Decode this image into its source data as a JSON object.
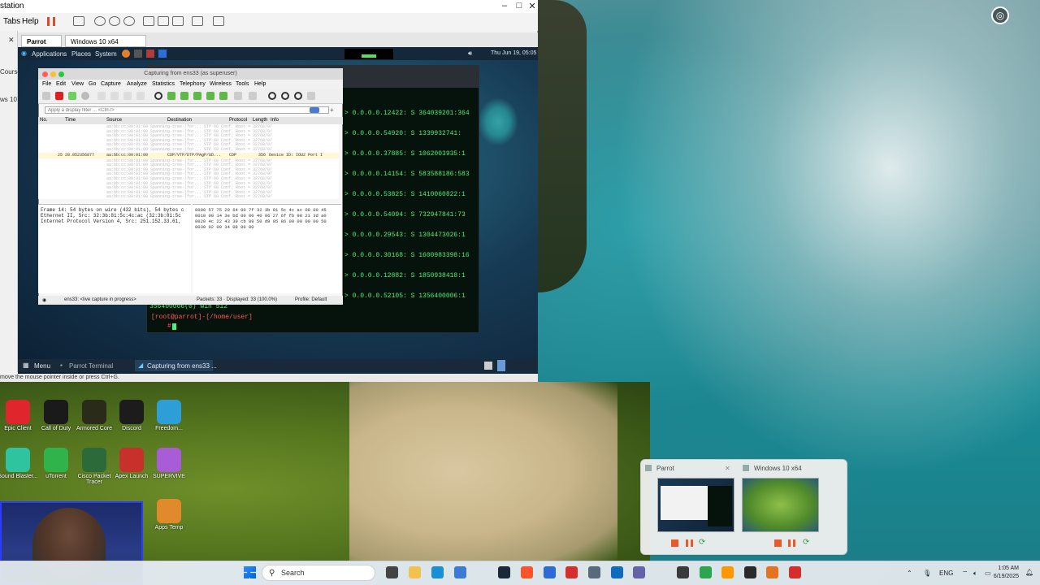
{
  "host": {
    "window_title": "station",
    "menu": [
      "Tabs",
      "Help"
    ],
    "tabs": [
      "Parrot",
      "Windows 10 x64"
    ],
    "left_panel": [
      "Course",
      "ws 10"
    ],
    "status_hint": "move the mouse pointer inside or press Ctrl+G."
  },
  "parrot": {
    "panel": {
      "applications": "Applications",
      "places": "Places",
      "system": "System",
      "clock": "Thu Jun 19, 05:05"
    },
    "bottom": {
      "menu": "Menu",
      "task1": "Parrot Terminal",
      "task2": "Capturing from ens33 ..."
    }
  },
  "terminal": {
    "lines": [
      "> 0.0.0.0.12422: S 364039201:364",
      "> 0.0.0.0.54920: S 1339932741:",
      "> 0.0.0.0.37885: S 1062003935:1",
      "> 0.0.0.0.14154: S 583588186:583",
      "> 0.0.0.0.53825: S 1410060822:1",
      "> 0.0.0.0.54094: S 732947841:73",
      "> 0.0.0.0.29543: S 1304473026:1",
      "> 0.0.0.0.30168: S 1600983398:16",
      "> 0.0.0.0.12882: S 1850938418:1",
      "> 0.0.0.0.52105: S 1356400006:1"
    ],
    "last_output": "356400006(0) win 512",
    "prompt": "[root@parrot]-[/home/user]",
    "prompt2": "#"
  },
  "wireshark": {
    "title": "Capturing from ens33 (as superuser)",
    "menu": [
      "File",
      "Edit",
      "View",
      "Go",
      "Capture",
      "Analyze",
      "Statistics",
      "Telephony",
      "Wireless",
      "Tools",
      "Help"
    ],
    "filter_placeholder": "Apply a display filter ... <Ctrl-/>",
    "columns": [
      "No.",
      "Time",
      "Source",
      "Destination",
      "Protocol",
      "Length",
      "Info"
    ],
    "selected_row": {
      "no": "25",
      "time": "28.052356877",
      "source": "aa:bb:cc:00:01:00",
      "destination": "CDP/VTP/DTP/PAgP/UD...",
      "protocol": "CDP",
      "length": "356",
      "info": "Device ID: IOU2  Port I"
    },
    "faded_row_text": "aa:bb:cc:00:01:00   Spanning-tree-(for...  STP   60 Conf. Root = 32768/0/",
    "detail": [
      "Frame 14: 54 bytes on wire (432 bits), 54 bytes c",
      "Ethernet II, Src: 32:3b:81:5c:4c:ac (32:3b:81:5c",
      "Internet Protocol Version 4, Src: 251.152.33.61,"
    ],
    "hex": [
      "0000  57 75 29 64 00 7f 32 3b  81 5c 4c ac 08 00 45",
      "0010  00 14 3e bd 00 00 40 06  27 6f fb 98 21 3d a0",
      "0020  4c 22 43 39 cb 89 50 d9  05 86 00 00 00 00 50",
      "0030  02 00 34 08 00 00"
    ],
    "status": {
      "iface": "ens33: <live capture in progress>",
      "packets": "Packets: 33 · Displayed: 33 (100.0%)",
      "profile": "Profile: Default"
    }
  },
  "desktop_icons": [
    {
      "label": "Epic Client",
      "color": "#e0262c"
    },
    {
      "label": "Call of Duty",
      "color": "#1a1a1a"
    },
    {
      "label": "Armored Core",
      "color": "#2b2b1a"
    },
    {
      "label": "Discord",
      "color": "#1c1c1c"
    },
    {
      "label": "Freedom...",
      "color": "#2e9fd6"
    },
    {
      "label": "Sound Blaster...",
      "color": "#2ec4a0"
    },
    {
      "label": "uTorrent",
      "color": "#2fb34a"
    },
    {
      "label": "Cisco Packet Tracer",
      "color": "#2c6a3a"
    },
    {
      "label": "Apex Launch",
      "color": "#c8302c"
    },
    {
      "label": "SUPERVIVE",
      "color": "#a85cd6"
    },
    {
      "label": "Apps Temp",
      "color": "#e08a2c"
    }
  ],
  "switcher": {
    "items": [
      "Parrot",
      "Windows 10 x64"
    ]
  },
  "taskbar": {
    "search": "Search",
    "lang": "ENG",
    "time": "1:05 AM",
    "date": "6/19/2025"
  },
  "widget": {
    "label": "Learn about this picture"
  }
}
